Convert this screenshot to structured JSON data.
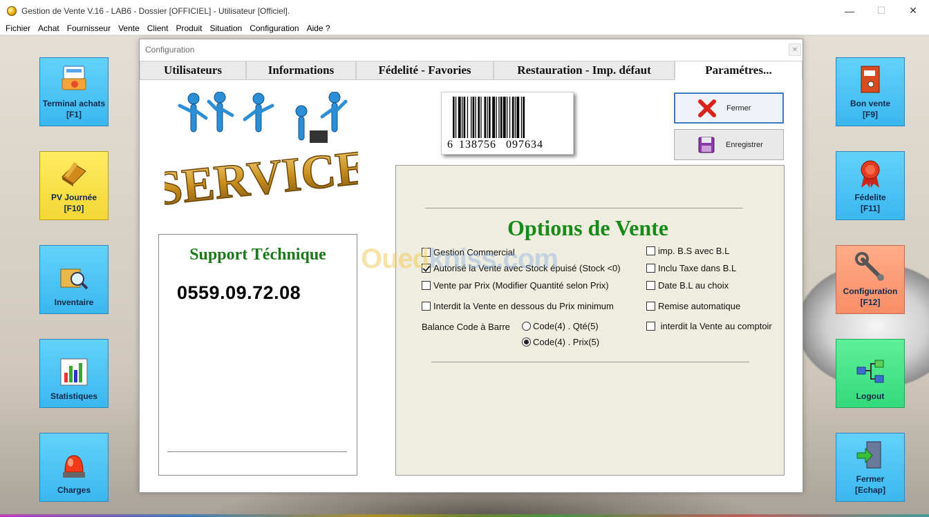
{
  "window": {
    "title": "Gestion de Vente V.16 - LAB6 - Dossier [OFFICIEL] - Utilisateur [Officiel].",
    "controls": {
      "minimize": "—",
      "maximize": "☐",
      "close": "✕"
    }
  },
  "menu": [
    "Fichier",
    "Achat",
    "Fournisseur",
    "Vente",
    "Client",
    "Produit",
    "Situation",
    "Configuration",
    "Aide ?"
  ],
  "left_tiles": [
    {
      "line1": "Terminal achats",
      "line2": "[F1]",
      "icon": "cash-register-icon"
    },
    {
      "line1": "PV Journée",
      "line2": "[F10]",
      "icon": "notebook-pencil-icon"
    },
    {
      "line1": "Inventaire",
      "line2": "",
      "icon": "magnifier-box-icon"
    },
    {
      "line1": "Statistiques",
      "line2": "",
      "icon": "bar-chart-icon"
    },
    {
      "line1": "Charges",
      "line2": "",
      "icon": "alarm-light-icon"
    }
  ],
  "right_tiles": [
    {
      "line1": "Bon vente",
      "line2": "[F9]",
      "icon": "binder-icon"
    },
    {
      "line1": "Fédelite",
      "line2": "[F11]",
      "icon": "award-ribbon-icon"
    },
    {
      "line1": "Configuration",
      "line2": "[F12]",
      "icon": "wrench-icon"
    },
    {
      "line1": "Logout",
      "line2": "",
      "icon": "network-icon"
    },
    {
      "line1": "Fermer",
      "line2": "[Echap]",
      "icon": "exit-door-icon"
    }
  ],
  "dialog": {
    "title": "Configuration",
    "close": "✕",
    "tabs": [
      "Utilisateurs",
      "Informations",
      "Fédelité - Favories",
      "Restauration - Imp. défaut",
      "Paramétres..."
    ],
    "barcode_digits": [
      "6",
      "138756",
      "097634"
    ],
    "buttons": {
      "close_label": "Fermer",
      "save_label": "Enregistrer"
    },
    "support": {
      "title": "Support Téchnique",
      "phone": "0559.09.72.08"
    },
    "options": {
      "title": "Options de Vente",
      "left": [
        {
          "label": "Gestion Commercial",
          "checked": false
        },
        {
          "label": "Autorisé la Vente avec Stock épuisé (Stock <0)",
          "checked": true
        },
        {
          "label": "Vente par Prix (Modifier Quantité selon Prix)",
          "checked": false
        },
        {
          "label": "Interdit la Vente en dessous du Prix minimum",
          "checked": false
        }
      ],
      "right": [
        {
          "label": "imp. B.S avec B.L",
          "checked": false
        },
        {
          "label": "Inclu Taxe dans B.L",
          "checked": false
        },
        {
          "label": "Date B.L au choix",
          "checked": false
        },
        {
          "label": "Remise automatique",
          "checked": false
        },
        {
          "label": " interdit la Vente au comptoir",
          "checked": false
        }
      ],
      "balance_label": "Balance Code à Barre",
      "radios": [
        {
          "label": "Code(4) . Qté(5)",
          "checked": false
        },
        {
          "label": "Code(4) . Prix(5)",
          "checked": true
        }
      ]
    },
    "watermark": {
      "part1": "Oued",
      "part2": "kniss.com"
    }
  },
  "colors": {
    "tile_blue": "#3bb7ef",
    "tile_yellow": "#f4d735",
    "tile_salmon": "#f98e68",
    "tile_green": "#33d97a",
    "title_green": "#178a17",
    "options_bg": "#efede0"
  }
}
